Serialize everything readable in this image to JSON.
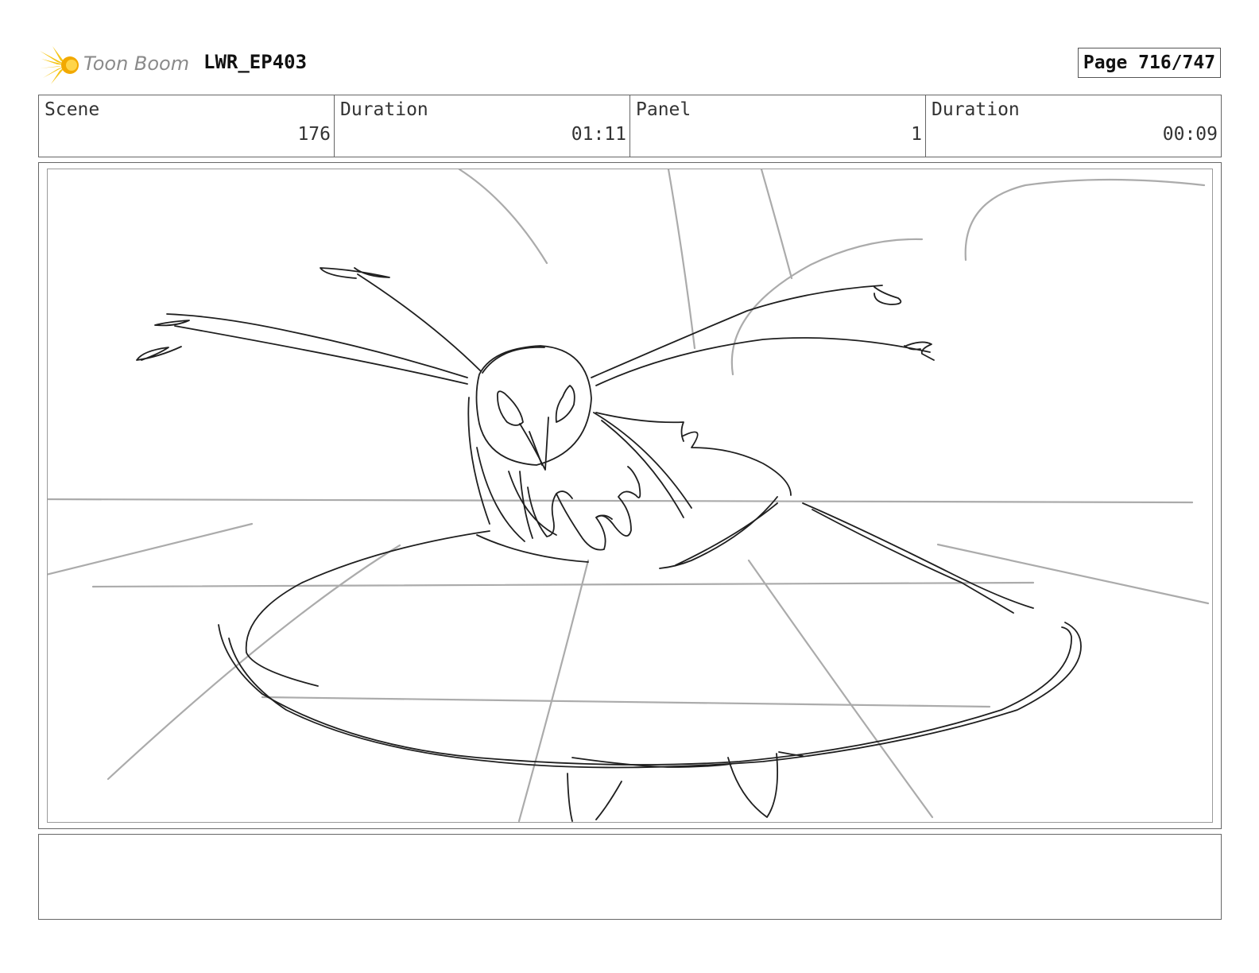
{
  "header": {
    "brand_name": "Toon Boom",
    "project_title": "LWR_EP403",
    "page_label": "Page 716/747"
  },
  "info": {
    "scene_label": "Scene",
    "scene_value": "176",
    "scene_duration_label": "Duration",
    "scene_duration_value": "01:11",
    "panel_label": "Panel",
    "panel_value": "1",
    "panel_duration_label": "Duration",
    "panel_duration_value": "00:09"
  },
  "colors": {
    "logo_accent": "#f5c518",
    "sketch_ink": "#1f1f1f",
    "construction_lines": "#ababab"
  },
  "icons": {
    "logo": "toon-boom-logo-icon"
  },
  "notes": {
    "text": ""
  }
}
